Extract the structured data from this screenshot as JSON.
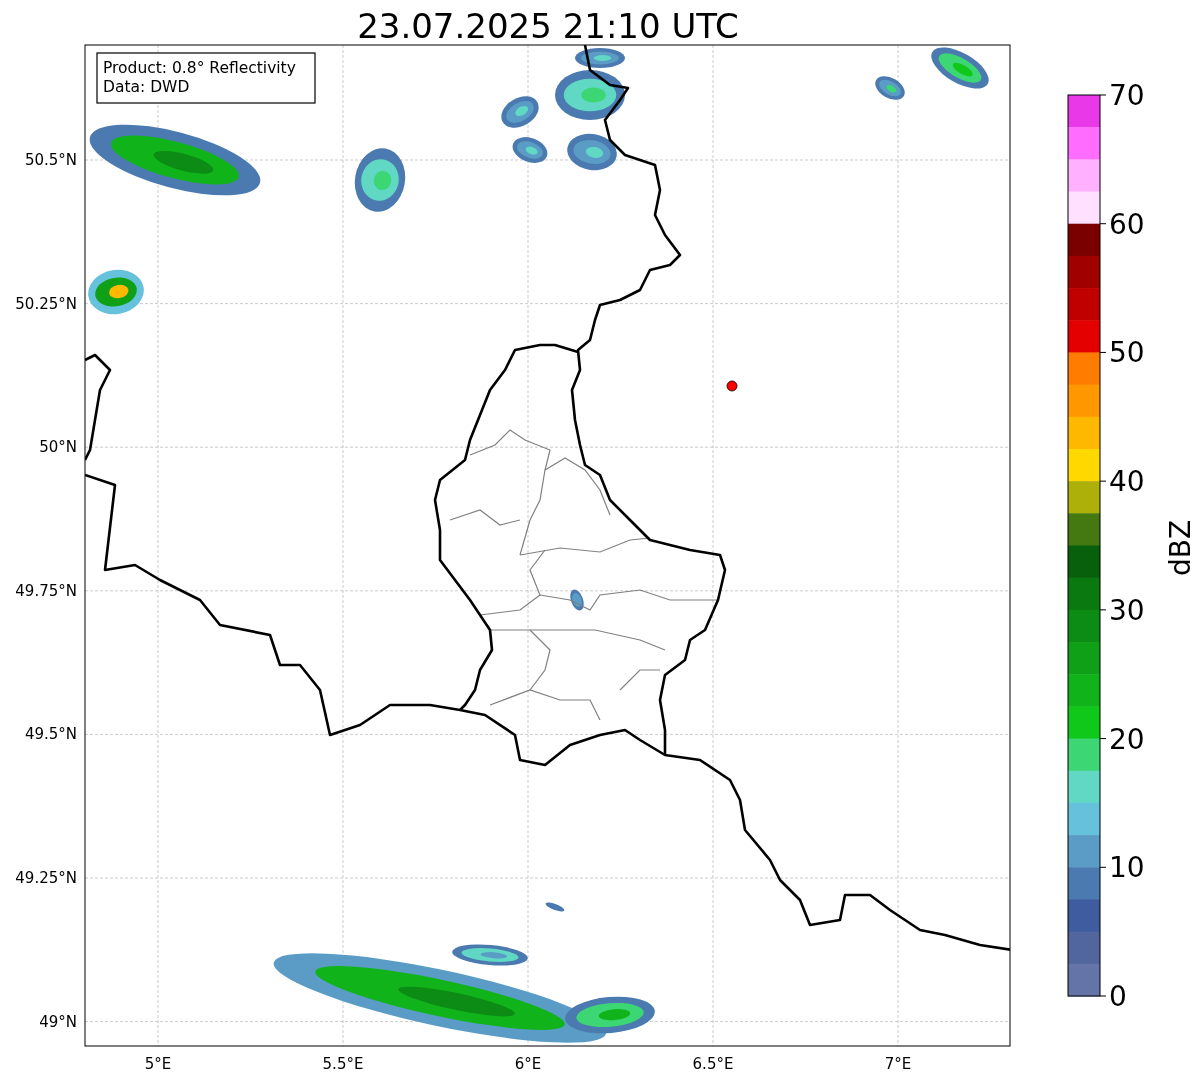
{
  "title": "23.07.2025 21:10 UTC",
  "info_box": {
    "lines": [
      "Product: 0.8° Reflectivity",
      "Data: DWD"
    ]
  },
  "map": {
    "x_tick_labels": [
      "5°E",
      "5.5°E",
      "6°E",
      "6.5°E",
      "7°E"
    ],
    "y_tick_labels": [
      "50.5°N",
      "50.25°N",
      "50°N",
      "49.75°N",
      "49.5°N",
      "49.25°N",
      "49°N"
    ]
  },
  "colorbar": {
    "label": "dBZ",
    "tick_labels": [
      "70",
      "60",
      "50",
      "40",
      "30",
      "20",
      "10",
      "0"
    ],
    "segments": [
      {
        "color": "#e838e8"
      },
      {
        "color": "#ff6cff"
      },
      {
        "color": "#ffb0ff"
      },
      {
        "color": "#ffe0ff"
      },
      {
        "color": "#7a0000"
      },
      {
        "color": "#a00000"
      },
      {
        "color": "#c00000"
      },
      {
        "color": "#e40000"
      },
      {
        "color": "#ff7c00"
      },
      {
        "color": "#ff9800"
      },
      {
        "color": "#ffb800"
      },
      {
        "color": "#ffd800"
      },
      {
        "color": "#acb008"
      },
      {
        "color": "#447810"
      },
      {
        "color": "#08600c"
      },
      {
        "color": "#0a7a10"
      },
      {
        "color": "#0c8c14"
      },
      {
        "color": "#10a018"
      },
      {
        "color": "#10b41a"
      },
      {
        "color": "#10c81a"
      },
      {
        "color": "#3cd674"
      },
      {
        "color": "#60d8c4"
      },
      {
        "color": "#66c2dc"
      },
      {
        "color": "#5a9cc6"
      },
      {
        "color": "#4a7ab0"
      },
      {
        "color": "#405ca0"
      },
      {
        "color": "#52669e"
      },
      {
        "color": "#6474a8"
      }
    ]
  }
}
